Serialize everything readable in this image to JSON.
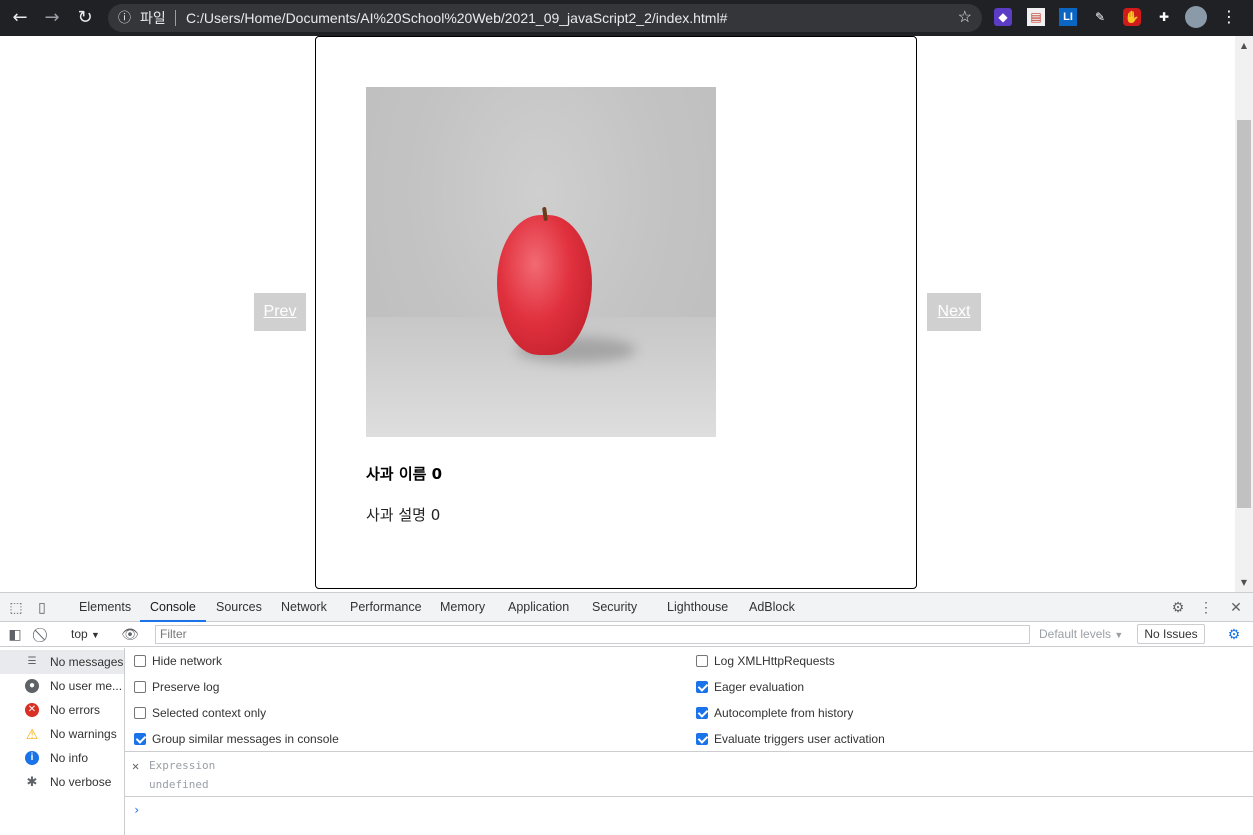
{
  "browser": {
    "scheme_label": "파일",
    "url": "C:/Users/Home/Documents/AI%20School%20Web/2021_09_javaScript2_2/index.html#"
  },
  "page": {
    "prev_label": "Prev",
    "next_label": "Next",
    "card": {
      "title": "사과 이름 0",
      "description": "사과 설명 0"
    }
  },
  "devtools": {
    "tabs": [
      "Elements",
      "Console",
      "Sources",
      "Network",
      "Performance",
      "Memory",
      "Application",
      "Security",
      "Lighthouse",
      "AdBlock"
    ],
    "active_tab": "Console",
    "context": "top",
    "filter_placeholder": "Filter",
    "levels_label": "Default levels",
    "issues_label": "No Issues",
    "sidebar": [
      {
        "label": "No messages",
        "icon": "list-icon"
      },
      {
        "label": "No user me...",
        "icon": "user-icon"
      },
      {
        "label": "No errors",
        "icon": "error-icon"
      },
      {
        "label": "No warnings",
        "icon": "warning-icon"
      },
      {
        "label": "No info",
        "icon": "info-icon"
      },
      {
        "label": "No verbose",
        "icon": "bug-icon"
      }
    ],
    "settings_left": [
      {
        "label": "Hide network",
        "checked": false
      },
      {
        "label": "Preserve log",
        "checked": false
      },
      {
        "label": "Selected context only",
        "checked": false
      },
      {
        "label": "Group similar messages in console",
        "checked": true
      }
    ],
    "settings_right": [
      {
        "label": "Log XMLHttpRequests",
        "checked": false
      },
      {
        "label": "Eager evaluation",
        "checked": true
      },
      {
        "label": "Autocomplete from history",
        "checked": true
      },
      {
        "label": "Evaluate triggers user activation",
        "checked": true
      }
    ],
    "expression": {
      "label": "Expression",
      "value": "undefined"
    }
  },
  "colors": {
    "accent": "#1a73e8",
    "error": "#d93025",
    "warning": "#f9ab00",
    "info": "#1a73e8",
    "apple": "#e0303d"
  }
}
